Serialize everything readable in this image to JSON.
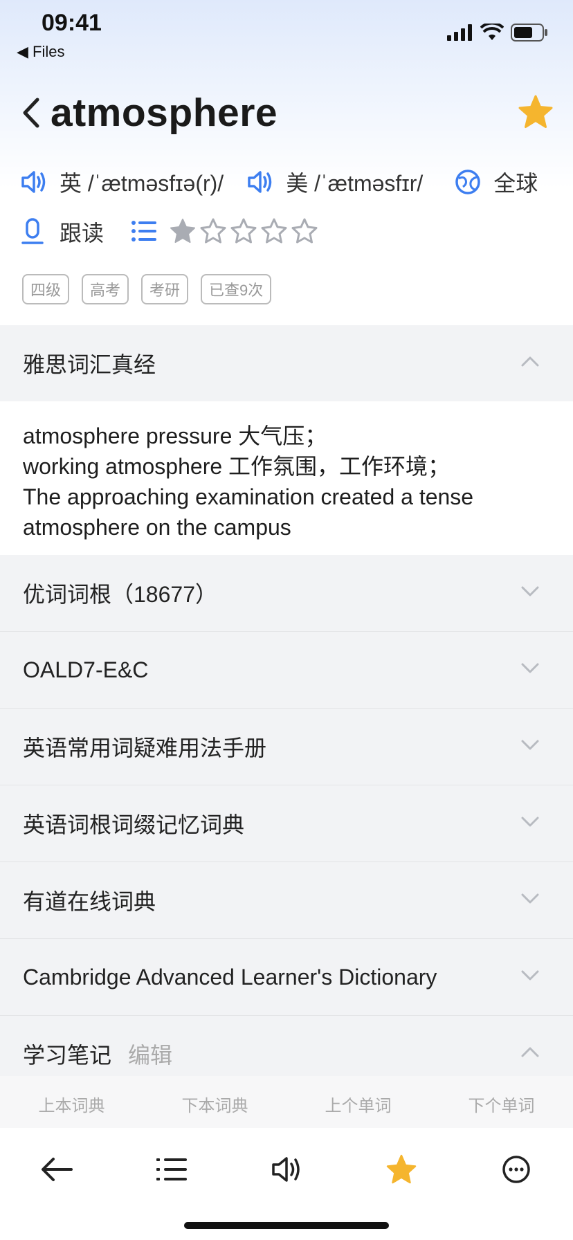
{
  "status": {
    "time": "09:41",
    "back_app": "◀ Files"
  },
  "word": "atmosphere",
  "pronunciation": {
    "uk": "英 /ˈætməsfɪə(r)/",
    "us": "美 /ˈætməsfɪr/",
    "global": "全球"
  },
  "follow_read": "跟读",
  "rating": {
    "filled": 1,
    "total": 5
  },
  "tags": [
    "四级",
    "高考",
    "考研",
    "已查9次"
  ],
  "sections": {
    "ielts": "雅思词汇真经",
    "ielts_lines": [
      "atmosphere pressure 大气压；",
      "working atmosphere 工作氛围，工作环境；",
      "The approaching examination created a tense",
      "atmosphere on the campus"
    ],
    "youci": "优词词根（18677）",
    "oald": "OALD7-E&C",
    "handbook": "英语常用词疑难用法手册",
    "roots": "英语词根词缀记忆词典",
    "youdao": "有道在线词典",
    "cambridge": "Cambridge Advanced Learner's Dictionary",
    "notes": "学习笔记",
    "notes_edit": "编辑"
  },
  "nav_labels": [
    "上本词典",
    "下本词典",
    "上个单词",
    "下个单词"
  ],
  "colors": {
    "accent": "#3d7ef0",
    "star": "#f5b52e",
    "gray_star": "#a9acb3"
  },
  "icons": [
    "back-arrow-icon",
    "list-icon",
    "speaker-icon",
    "star-icon",
    "more-icon"
  ]
}
